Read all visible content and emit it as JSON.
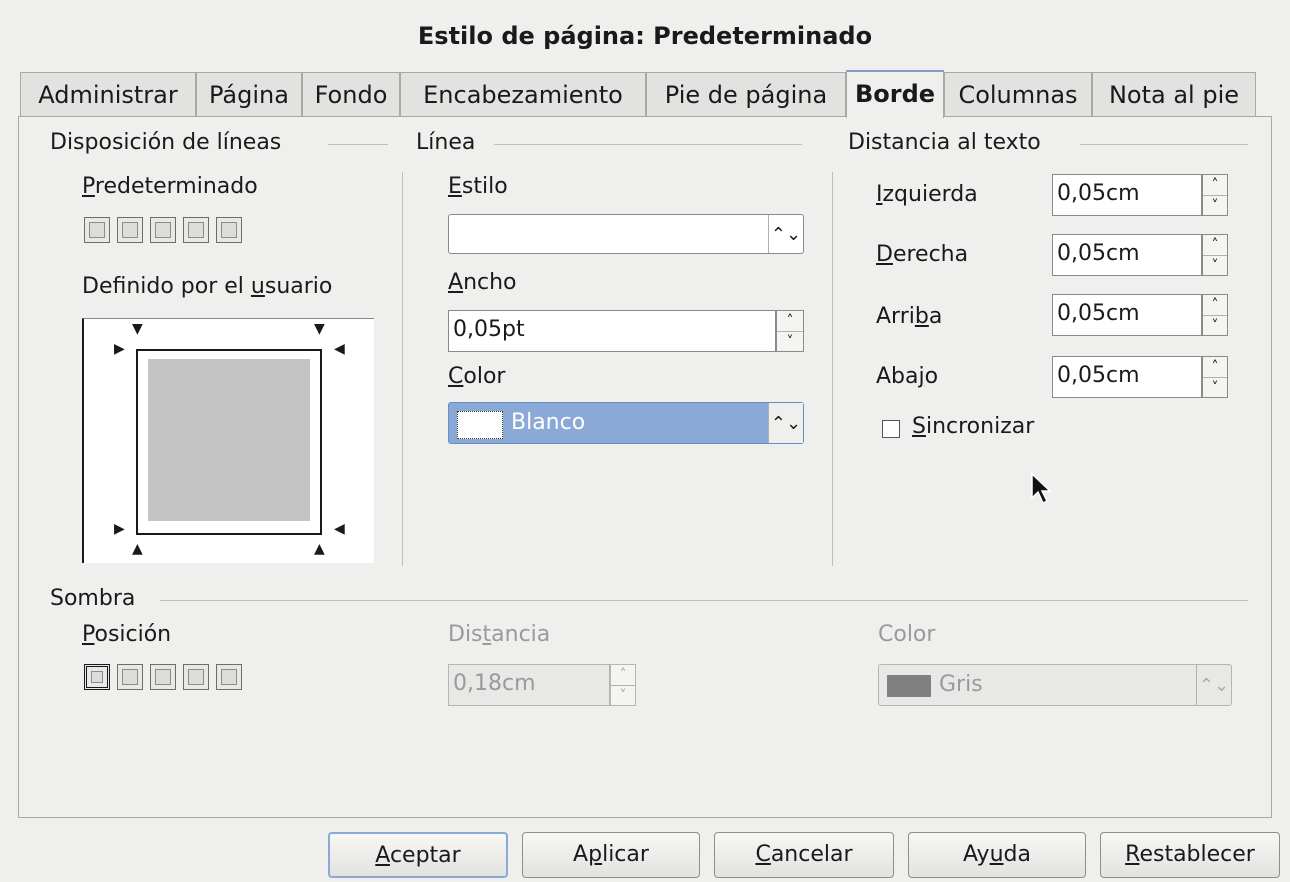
{
  "dialog": {
    "title": "Estilo de página: Predeterminado"
  },
  "tabs": [
    {
      "label": "Administrar"
    },
    {
      "label": "Página"
    },
    {
      "label": "Fondo"
    },
    {
      "label": "Encabezamiento"
    },
    {
      "label": "Pie de página"
    },
    {
      "label": "Borde",
      "active": true
    },
    {
      "label": "Columnas"
    },
    {
      "label": "Nota al pie"
    }
  ],
  "line_arrangement": {
    "heading": "Disposición de líneas",
    "default_label": "Predeterminado",
    "user_defined_label": "Definido por el usuario"
  },
  "line": {
    "heading": "Línea",
    "style_label": "Estilo",
    "style_value": "",
    "width_label": "Ancho",
    "width_value": "0,05pt",
    "color_label": "Color",
    "color_value": "Blanco"
  },
  "spacing": {
    "heading": "Distancia al texto",
    "left_label": "Izquierda",
    "left_value": "0,05cm",
    "right_label": "Derecha",
    "right_value": "0,05cm",
    "top_label": "Arriba",
    "top_value": "0,05cm",
    "bottom_label": "Abajo",
    "bottom_value": "0,05cm",
    "sync_label": "Sincronizar",
    "sync_checked": false
  },
  "shadow": {
    "heading": "Sombra",
    "position_label": "Posición",
    "distance_label": "Distancia",
    "distance_value": "0,18cm",
    "color_label": "Color",
    "color_value": "Gris"
  },
  "buttons": {
    "ok": "Aceptar",
    "apply": "Aplicar",
    "cancel": "Cancelar",
    "help": "Ayuda",
    "reset": "Restablecer"
  },
  "colors": {
    "selection": "#8aa9d6",
    "swatch_white": "#ffffff",
    "swatch_gray": "#808080"
  }
}
